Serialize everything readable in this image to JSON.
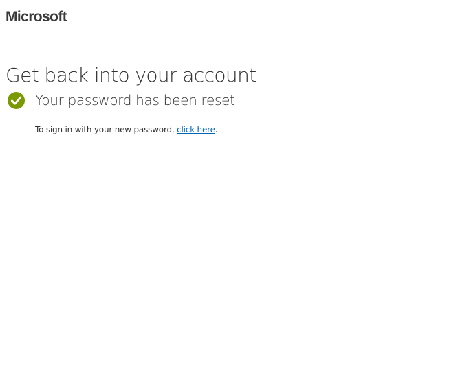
{
  "brand": {
    "name": "Microsoft"
  },
  "page": {
    "title": "Get back into your account"
  },
  "status": {
    "icon": "check-circle-icon",
    "color": "#7a9a01",
    "message": "Your password has been reset"
  },
  "signin": {
    "prefix": "To sign in with your new password, ",
    "link_text": "click here",
    "suffix": ".",
    "link_color": "#0067b8"
  }
}
